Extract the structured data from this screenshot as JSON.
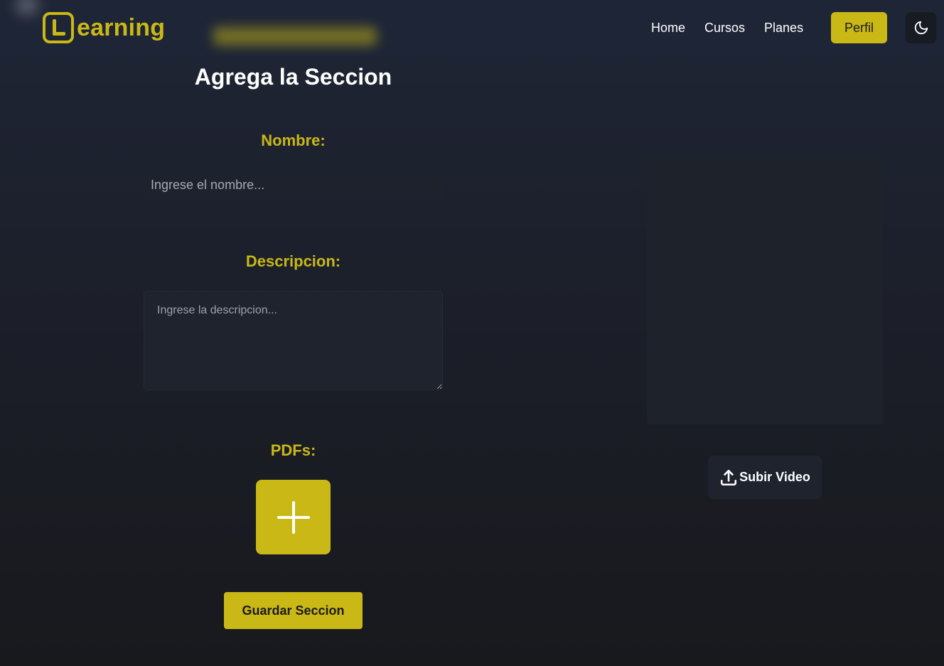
{
  "brand": {
    "logo_text": "earning",
    "logo_letter": "L",
    "accent_color": "#c9b816"
  },
  "nav": {
    "links": [
      {
        "label": "Home"
      },
      {
        "label": "Cursos"
      },
      {
        "label": "Planes"
      }
    ],
    "profile_button": "Perfil",
    "theme_toggle_icon": "moon-icon"
  },
  "form": {
    "title": "Agrega la Seccion",
    "name_label": "Nombre:",
    "name_placeholder": "Ingrese el nombre...",
    "name_value": "",
    "description_label": "Descripcion:",
    "description_placeholder": "Ingrese la descripcion...",
    "description_value": "",
    "pdfs_label": "PDFs:",
    "add_pdf_icon": "plus-icon",
    "save_button": "Guardar Seccion"
  },
  "video": {
    "upload_icon": "upload-icon",
    "upload_button": "Subir Video"
  }
}
